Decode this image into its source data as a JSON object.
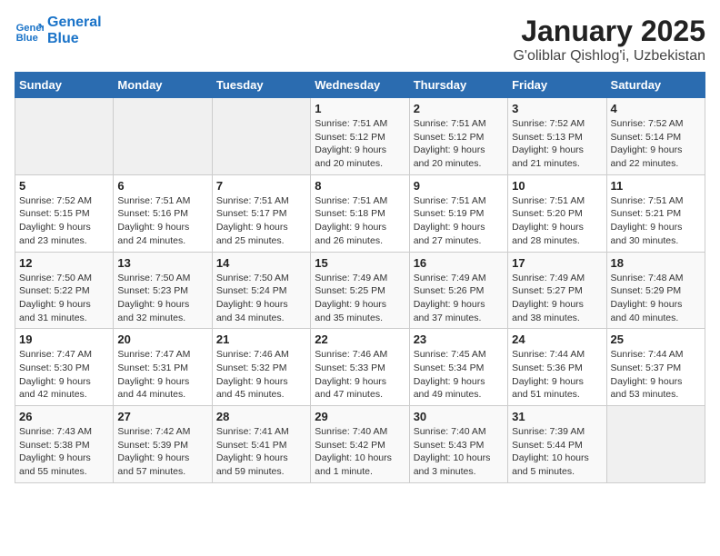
{
  "logo": {
    "line1": "General",
    "line2": "Blue"
  },
  "title": "January 2025",
  "subtitle": "G'oliblar Qishlog'i, Uzbekistan",
  "weekdays": [
    "Sunday",
    "Monday",
    "Tuesday",
    "Wednesday",
    "Thursday",
    "Friday",
    "Saturday"
  ],
  "weeks": [
    [
      {
        "day": "",
        "info": ""
      },
      {
        "day": "",
        "info": ""
      },
      {
        "day": "",
        "info": ""
      },
      {
        "day": "1",
        "info": "Sunrise: 7:51 AM\nSunset: 5:12 PM\nDaylight: 9 hours\nand 20 minutes."
      },
      {
        "day": "2",
        "info": "Sunrise: 7:51 AM\nSunset: 5:12 PM\nDaylight: 9 hours\nand 20 minutes."
      },
      {
        "day": "3",
        "info": "Sunrise: 7:52 AM\nSunset: 5:13 PM\nDaylight: 9 hours\nand 21 minutes."
      },
      {
        "day": "4",
        "info": "Sunrise: 7:52 AM\nSunset: 5:14 PM\nDaylight: 9 hours\nand 22 minutes."
      }
    ],
    [
      {
        "day": "5",
        "info": "Sunrise: 7:52 AM\nSunset: 5:15 PM\nDaylight: 9 hours\nand 23 minutes."
      },
      {
        "day": "6",
        "info": "Sunrise: 7:51 AM\nSunset: 5:16 PM\nDaylight: 9 hours\nand 24 minutes."
      },
      {
        "day": "7",
        "info": "Sunrise: 7:51 AM\nSunset: 5:17 PM\nDaylight: 9 hours\nand 25 minutes."
      },
      {
        "day": "8",
        "info": "Sunrise: 7:51 AM\nSunset: 5:18 PM\nDaylight: 9 hours\nand 26 minutes."
      },
      {
        "day": "9",
        "info": "Sunrise: 7:51 AM\nSunset: 5:19 PM\nDaylight: 9 hours\nand 27 minutes."
      },
      {
        "day": "10",
        "info": "Sunrise: 7:51 AM\nSunset: 5:20 PM\nDaylight: 9 hours\nand 28 minutes."
      },
      {
        "day": "11",
        "info": "Sunrise: 7:51 AM\nSunset: 5:21 PM\nDaylight: 9 hours\nand 30 minutes."
      }
    ],
    [
      {
        "day": "12",
        "info": "Sunrise: 7:50 AM\nSunset: 5:22 PM\nDaylight: 9 hours\nand 31 minutes."
      },
      {
        "day": "13",
        "info": "Sunrise: 7:50 AM\nSunset: 5:23 PM\nDaylight: 9 hours\nand 32 minutes."
      },
      {
        "day": "14",
        "info": "Sunrise: 7:50 AM\nSunset: 5:24 PM\nDaylight: 9 hours\nand 34 minutes."
      },
      {
        "day": "15",
        "info": "Sunrise: 7:49 AM\nSunset: 5:25 PM\nDaylight: 9 hours\nand 35 minutes."
      },
      {
        "day": "16",
        "info": "Sunrise: 7:49 AM\nSunset: 5:26 PM\nDaylight: 9 hours\nand 37 minutes."
      },
      {
        "day": "17",
        "info": "Sunrise: 7:49 AM\nSunset: 5:27 PM\nDaylight: 9 hours\nand 38 minutes."
      },
      {
        "day": "18",
        "info": "Sunrise: 7:48 AM\nSunset: 5:29 PM\nDaylight: 9 hours\nand 40 minutes."
      }
    ],
    [
      {
        "day": "19",
        "info": "Sunrise: 7:47 AM\nSunset: 5:30 PM\nDaylight: 9 hours\nand 42 minutes."
      },
      {
        "day": "20",
        "info": "Sunrise: 7:47 AM\nSunset: 5:31 PM\nDaylight: 9 hours\nand 44 minutes."
      },
      {
        "day": "21",
        "info": "Sunrise: 7:46 AM\nSunset: 5:32 PM\nDaylight: 9 hours\nand 45 minutes."
      },
      {
        "day": "22",
        "info": "Sunrise: 7:46 AM\nSunset: 5:33 PM\nDaylight: 9 hours\nand 47 minutes."
      },
      {
        "day": "23",
        "info": "Sunrise: 7:45 AM\nSunset: 5:34 PM\nDaylight: 9 hours\nand 49 minutes."
      },
      {
        "day": "24",
        "info": "Sunrise: 7:44 AM\nSunset: 5:36 PM\nDaylight: 9 hours\nand 51 minutes."
      },
      {
        "day": "25",
        "info": "Sunrise: 7:44 AM\nSunset: 5:37 PM\nDaylight: 9 hours\nand 53 minutes."
      }
    ],
    [
      {
        "day": "26",
        "info": "Sunrise: 7:43 AM\nSunset: 5:38 PM\nDaylight: 9 hours\nand 55 minutes."
      },
      {
        "day": "27",
        "info": "Sunrise: 7:42 AM\nSunset: 5:39 PM\nDaylight: 9 hours\nand 57 minutes."
      },
      {
        "day": "28",
        "info": "Sunrise: 7:41 AM\nSunset: 5:41 PM\nDaylight: 9 hours\nand 59 minutes."
      },
      {
        "day": "29",
        "info": "Sunrise: 7:40 AM\nSunset: 5:42 PM\nDaylight: 10 hours\nand 1 minute."
      },
      {
        "day": "30",
        "info": "Sunrise: 7:40 AM\nSunset: 5:43 PM\nDaylight: 10 hours\nand 3 minutes."
      },
      {
        "day": "31",
        "info": "Sunrise: 7:39 AM\nSunset: 5:44 PM\nDaylight: 10 hours\nand 5 minutes."
      },
      {
        "day": "",
        "info": ""
      }
    ]
  ]
}
